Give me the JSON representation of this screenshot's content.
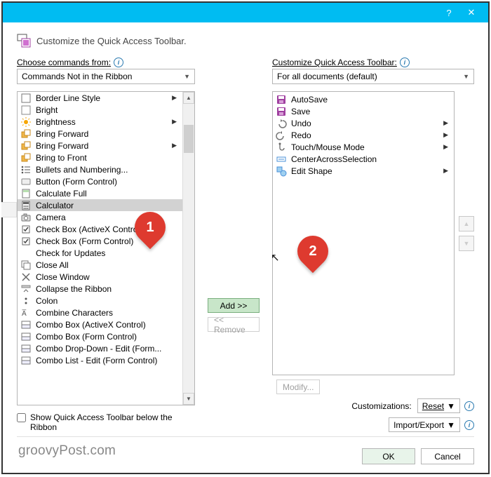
{
  "titlebar": {
    "help": "?",
    "close": "✕"
  },
  "header": {
    "title": "Customize the Quick Access Toolbar."
  },
  "left": {
    "label": "Choose commands from:",
    "dropdown": "Commands Not in the Ribbon",
    "items": [
      {
        "label": "Border Line Style",
        "sub": true
      },
      {
        "label": "Bright"
      },
      {
        "label": "Brightness",
        "sub": true
      },
      {
        "label": "Bring Forward"
      },
      {
        "label": "Bring Forward",
        "sub": true
      },
      {
        "label": "Bring to Front"
      },
      {
        "label": "Bullets and Numbering..."
      },
      {
        "label": "Button (Form Control)"
      },
      {
        "label": "Calculate Full"
      },
      {
        "label": "Calculator",
        "selected": true
      },
      {
        "label": "Camera"
      },
      {
        "label": "Check Box (ActiveX Control)"
      },
      {
        "label": "Check Box (Form Control)"
      },
      {
        "label": "Check for Updates"
      },
      {
        "label": "Close All"
      },
      {
        "label": "Close Window"
      },
      {
        "label": "Collapse the Ribbon"
      },
      {
        "label": "Colon"
      },
      {
        "label": "Combine Characters"
      },
      {
        "label": "Combo Box (ActiveX Control)"
      },
      {
        "label": "Combo Box (Form Control)"
      },
      {
        "label": "Combo Drop-Down - Edit (Form..."
      },
      {
        "label": "Combo List - Edit (Form Control)"
      }
    ],
    "showBelow": "Show Quick Access Toolbar below the Ribbon"
  },
  "mid": {
    "add": "Add >>",
    "remove": "<< Remove"
  },
  "right": {
    "label": "Customize Quick Access Toolbar:",
    "dropdown": "For all documents (default)",
    "items": [
      {
        "label": "AutoSave"
      },
      {
        "label": "Save"
      },
      {
        "label": "Undo",
        "sub": true
      },
      {
        "label": "Redo",
        "sub": true
      },
      {
        "label": "Touch/Mouse Mode",
        "sub": true
      },
      {
        "label": "CenterAcrossSelection"
      },
      {
        "label": "Edit Shape",
        "sub": true
      }
    ],
    "modify": "Modify...",
    "customizations": "Customizations:",
    "reset": "Reset",
    "importExport": "Import/Export"
  },
  "footer": {
    "ok": "OK",
    "cancel": "Cancel"
  },
  "callouts": {
    "c1": "1",
    "c2": "2"
  },
  "watermark": "groovyPost.com"
}
